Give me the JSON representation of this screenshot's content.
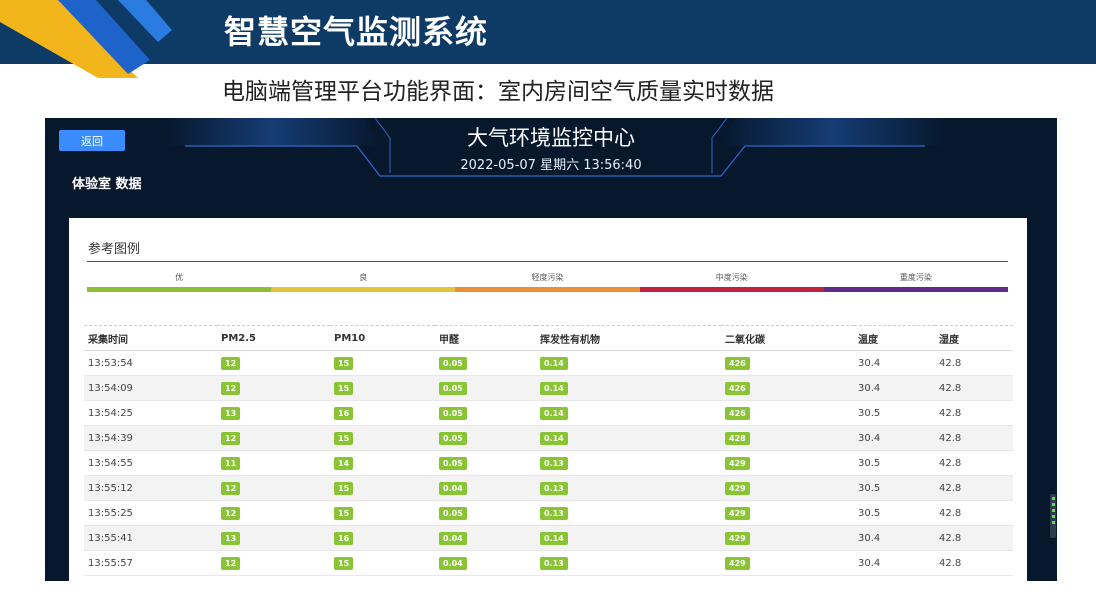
{
  "slide": {
    "title": "智慧空气监测系统",
    "subtitle": "电脑端管理平台功能界面：室内房间空气质量实时数据"
  },
  "app": {
    "back_label": "返回",
    "room_label": "体验室 数据",
    "center_title": "大气环境监控中心",
    "datetime": "2022-05-07 星期六 13:56:40"
  },
  "legend": {
    "title": "参考图例",
    "items": [
      {
        "label": "优",
        "color": "#8cbf34"
      },
      {
        "label": "良",
        "color": "#e4c23a"
      },
      {
        "label": "轻度污染",
        "color": "#ea8f35"
      },
      {
        "label": "中度污染",
        "color": "#c0243a"
      },
      {
        "label": "重度污染",
        "color": "#5e2d8c"
      }
    ]
  },
  "table": {
    "headers": [
      "采集时间",
      "PM2.5",
      "PM10",
      "甲醛",
      "挥发性有机物",
      "二氧化碳",
      "温度",
      "湿度"
    ],
    "rows": [
      [
        "13:53:54",
        "12",
        "15",
        "0.05",
        "0.14",
        "426",
        "30.4",
        "42.8"
      ],
      [
        "13:54:09",
        "12",
        "15",
        "0.05",
        "0.14",
        "426",
        "30.4",
        "42.8"
      ],
      [
        "13:54:25",
        "13",
        "16",
        "0.05",
        "0.14",
        "426",
        "30.5",
        "42.8"
      ],
      [
        "13:54:39",
        "12",
        "15",
        "0.05",
        "0.14",
        "428",
        "30.4",
        "42.8"
      ],
      [
        "13:54:55",
        "11",
        "14",
        "0.05",
        "0.13",
        "429",
        "30.5",
        "42.8"
      ],
      [
        "13:55:12",
        "12",
        "15",
        "0.04",
        "0.13",
        "429",
        "30.5",
        "42.8"
      ],
      [
        "13:55:25",
        "12",
        "15",
        "0.05",
        "0.13",
        "429",
        "30.5",
        "42.8"
      ],
      [
        "13:55:41",
        "13",
        "16",
        "0.04",
        "0.14",
        "429",
        "30.4",
        "42.8"
      ],
      [
        "13:55:57",
        "12",
        "15",
        "0.04",
        "0.13",
        "429",
        "30.4",
        "42.8"
      ]
    ],
    "badge_color": "#89c435"
  }
}
